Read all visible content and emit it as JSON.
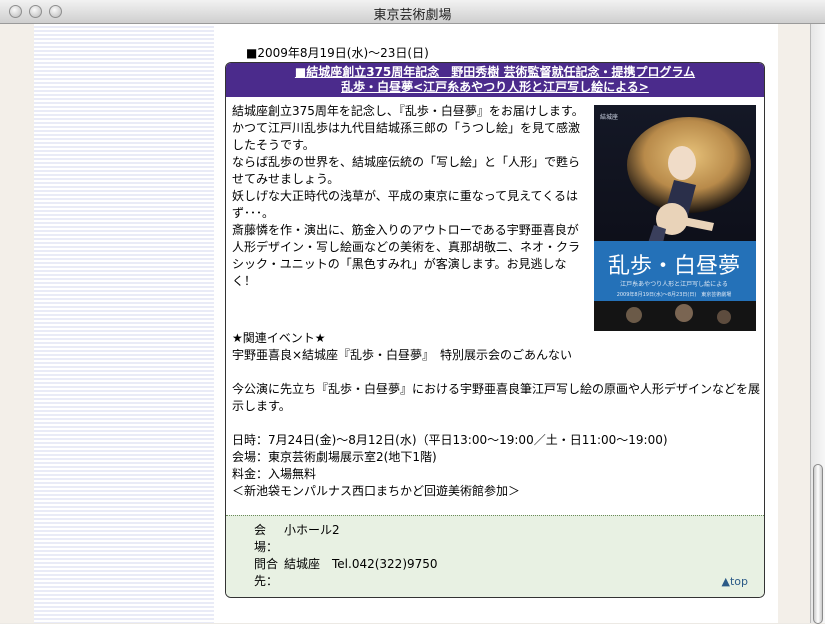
{
  "window": {
    "title": "東京芸術劇場",
    "buttons": [
      "close-button",
      "minimize-button",
      "zoom-button"
    ]
  },
  "event": {
    "date": "■2009年8月19日(水)〜23日(日)",
    "header_line1": "■結城座創立375周年記念　野田秀樹 芸術監督就任記念・提携プログラム",
    "header_line2": "乱歩・白昼夢<江戸糸あやつり人形と江戸写し絵による>",
    "paragraphs": [
      "結城座創立375周年を記念し、『乱歩・白昼夢』をお届けします。",
      "かつて江戸川乱歩は九代目結城孫三郎の「うつし絵」を見て感激したそうです。",
      "ならば乱歩の世界を、結城座伝統の「写し絵」と「人形」で甦らせてみせましょう。",
      "妖しげな大正時代の浅草が、平成の東京に重なって見えてくるはず･･･。",
      "斎藤憐を作・演出に、筋金入りのアウトローである宇野亜喜良が人形デザイン・写し絵画などの美術を、真那胡敬二、ネオ・クラシック・ユニットの「黒色すみれ」が客演します。お見逃しなく！"
    ],
    "poster": {
      "title": "乱歩・白昼夢",
      "subtitle": "江戸糸あやつり人形と江戸写し絵による",
      "top_label": "結城座",
      "bottom_info": "2009年8月19日(水)〜8月23日(日)　東京芸術劇場"
    },
    "related_heading": "★関連イベント★",
    "related_title": "宇野亜喜良×結城座『乱歩・白昼夢』　特別展示会のごあんない",
    "related_desc": "今公演に先立ち『乱歩・白昼夢』における宇野亜喜良筆江戸写し絵の原画や人形デザインなどを展示します。",
    "schedule": "日時：7月24日(金)〜8月12日(水)（平日13:00〜19:00／土・日11:00〜19:00)",
    "venue": "会場：東京芸術劇場展示室2(地下1階)",
    "fee": "料金：入場無料",
    "note": "＜新池袋モンパルナス西口まちかど回遊美術館参加＞"
  },
  "info": {
    "venue_label": "会場：",
    "venue_value": "小ホール2",
    "contact_label": "問合先：",
    "contact_value": "結城座　Tel.042(322)9750",
    "top_link": "▲top"
  }
}
